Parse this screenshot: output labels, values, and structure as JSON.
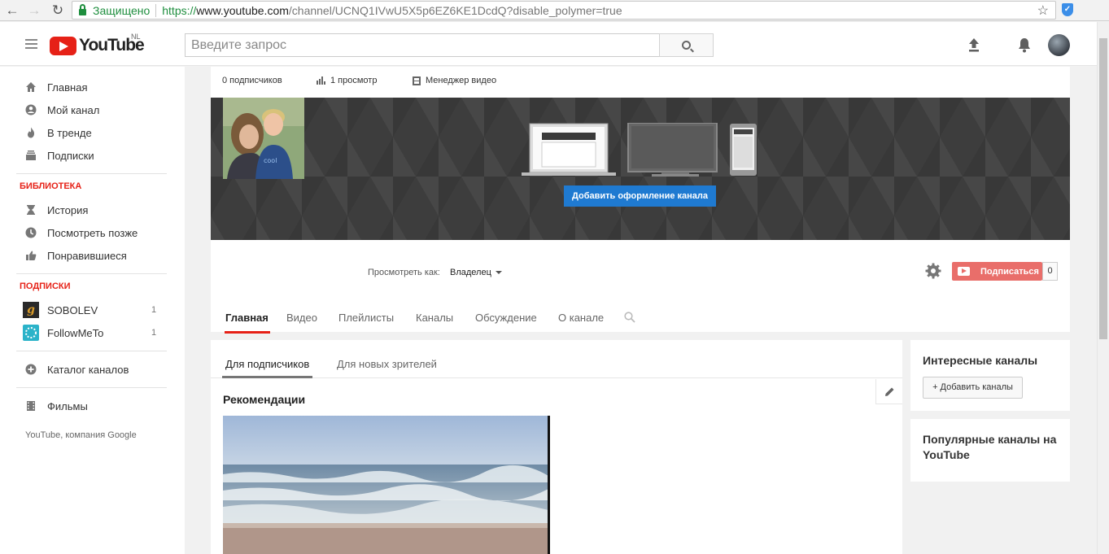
{
  "browser": {
    "secure_label": "Защищено",
    "url_proto": "https://",
    "url_host": "www.youtube.com",
    "url_path": "/channel/UCNQ1IVwU5X5p6EZ6KE1DcdQ?disable_polymer=true"
  },
  "masthead": {
    "logo_text": "YouTube",
    "region": "NL",
    "search_placeholder": "Введите запрос"
  },
  "sidebar": {
    "main_items": [
      {
        "label": "Главная",
        "icon": "home-icon"
      },
      {
        "label": "Мой канал",
        "icon": "account-icon"
      },
      {
        "label": "В тренде",
        "icon": "flame-icon"
      },
      {
        "label": "Подписки",
        "icon": "subscriptions-icon"
      }
    ],
    "library_header": "БИБЛИОТЕКА",
    "library_items": [
      {
        "label": "История",
        "icon": "hourglass-icon"
      },
      {
        "label": "Посмотреть позже",
        "icon": "clock-icon"
      },
      {
        "label": "Понравившиеся",
        "icon": "thumbs-up-icon"
      }
    ],
    "subs_header": "ПОДПИСКИ",
    "subscriptions": [
      {
        "label": "SOBOLEV",
        "count": "1"
      },
      {
        "label": "FollowMeTo",
        "count": "1"
      }
    ],
    "catalog_label": "Каталог каналов",
    "movies_label": "Фильмы",
    "footer": "YouTube, компания Google"
  },
  "channel": {
    "subscribers": "0 подписчиков",
    "views": "1 просмотр",
    "video_manager": "Менеджер видео",
    "banner_button": "Добавить оформление канала",
    "view_as_label": "Просмотреть как:",
    "view_as_value": "Владелец",
    "subscribe_label": "Подписаться",
    "subscribe_count": "0",
    "tabs": [
      "Главная",
      "Видео",
      "Плейлисты",
      "Каналы",
      "Обсуждение",
      "О канале"
    ]
  },
  "content": {
    "sub_tabs": [
      "Для подписчиков",
      "Для новых зрителей"
    ],
    "section_title": "Рекомендации"
  },
  "right": {
    "interesting_title": "Интересные каналы",
    "add_channels_button": "+ Добавить каналы",
    "popular_title": "Популярные каналы на YouTube"
  },
  "colors": {
    "brand_red": "#e62117",
    "banner_button_blue": "#1f7ad1",
    "subscribe_button": "#e96e6a",
    "secure_green": "#1e8e3e"
  }
}
